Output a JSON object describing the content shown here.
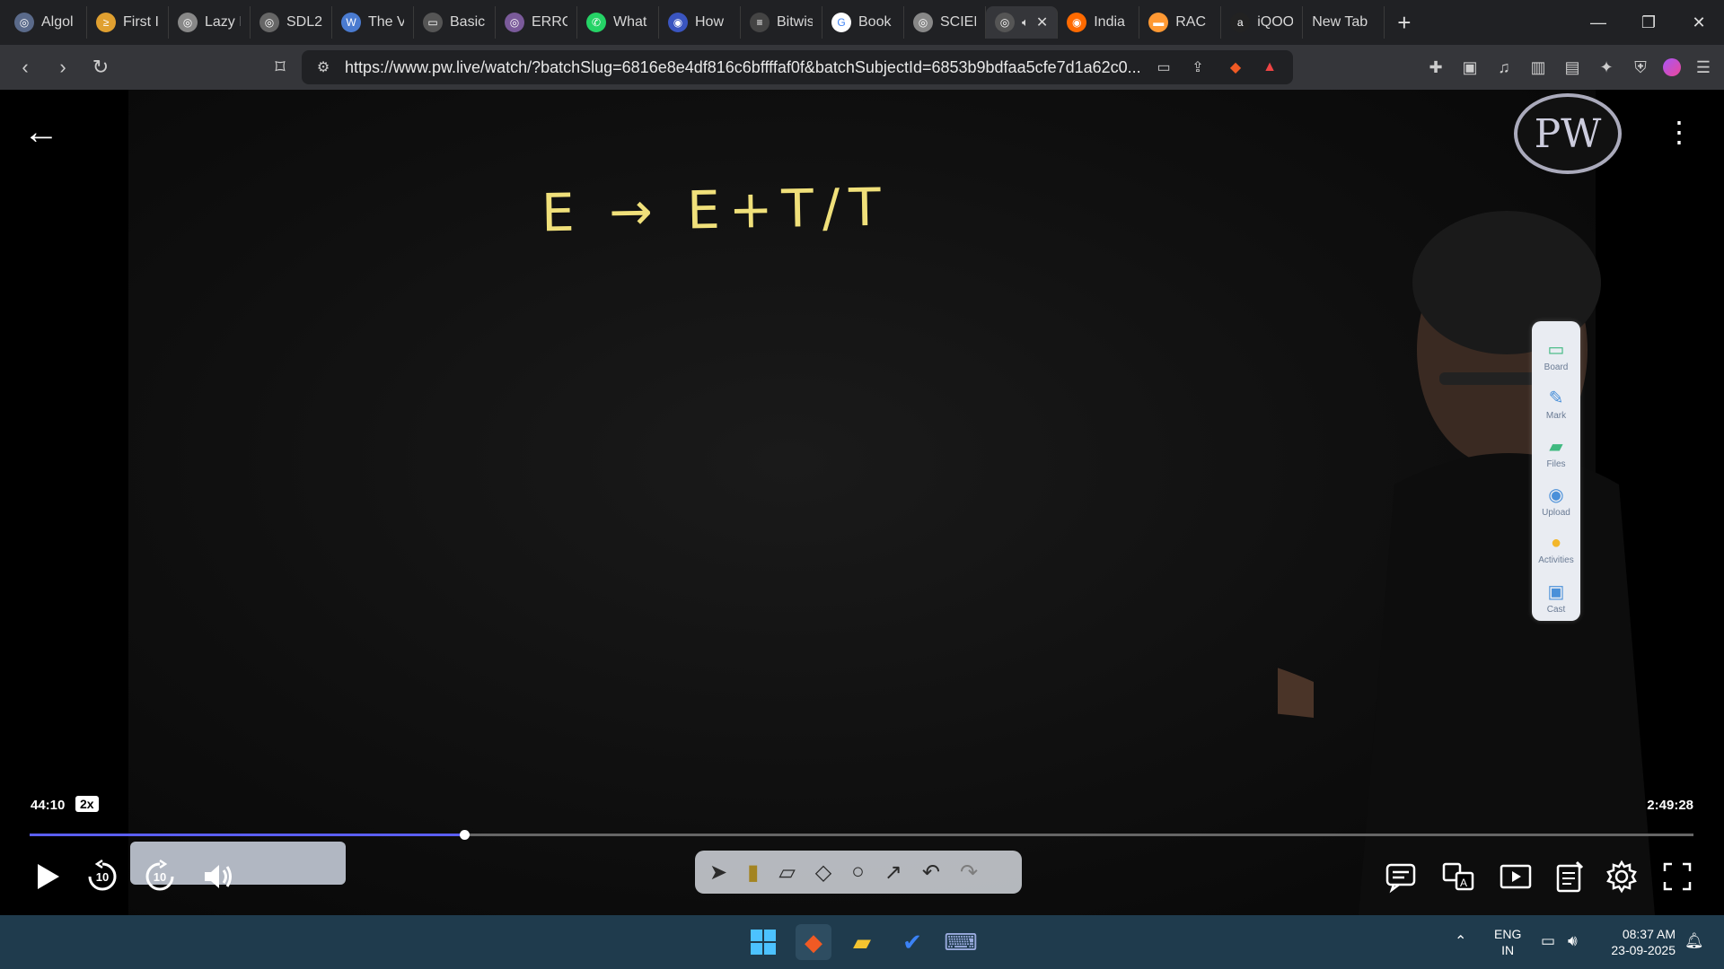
{
  "browser": {
    "tabs": [
      {
        "label": "Algol",
        "fav_color": "#5a6a8a",
        "fav_glyph": "◎"
      },
      {
        "label": "First I",
        "fav_color": "#e0a030",
        "fav_glyph": "≥"
      },
      {
        "label": "Lazy I",
        "fav_color": "#888888",
        "fav_glyph": "◎"
      },
      {
        "label": "SDL2",
        "fav_color": "#666666",
        "fav_glyph": "◎"
      },
      {
        "label": "The V",
        "fav_color": "#4a7bd0",
        "fav_glyph": "W"
      },
      {
        "label": "Basic",
        "fav_color": "#555555",
        "fav_glyph": "▭"
      },
      {
        "label": "ERRO",
        "fav_color": "#7a5a9a",
        "fav_glyph": "◎"
      },
      {
        "label": "What",
        "fav_color": "#25d366",
        "fav_glyph": "✆"
      },
      {
        "label": "How",
        "fav_color": "#3a55c0",
        "fav_glyph": "◉"
      },
      {
        "label": "Bitwis",
        "fav_color": "#444444",
        "fav_glyph": "≡"
      },
      {
        "label": "Book",
        "fav_color": "#ffffff",
        "fav_glyph": "G"
      },
      {
        "label": "SCIEN",
        "fav_color": "#888888",
        "fav_glyph": "◎"
      },
      {
        "label": "",
        "fav_color": "#555555",
        "fav_glyph": "◎",
        "active": true
      },
      {
        "label": "India",
        "fav_color": "#ff6a00",
        "fav_glyph": "◉"
      },
      {
        "label": "RAC",
        "fav_color": "#ff9933",
        "fav_glyph": "▬"
      },
      {
        "label": "iQOO",
        "fav_color": "#222222",
        "fav_glyph": "a"
      },
      {
        "label": "New Tab",
        "fav_color": "",
        "fav_glyph": ""
      }
    ],
    "url": "https://www.pw.live/watch/?batchSlug=6816e8e4df816c6bffffaf0f&batchSubjectId=6853b9bdfaa5cfe7d1a62c0..."
  },
  "video": {
    "board_text": "E → E+T/T",
    "logo_text": "PW",
    "side_tools": [
      {
        "label": "Board",
        "icon": "board-icon",
        "glyph": "▭"
      },
      {
        "label": "Mark",
        "icon": "pen-icon",
        "glyph": "✎"
      },
      {
        "label": "Files",
        "icon": "folder-icon",
        "glyph": "▰"
      },
      {
        "label": "Upload",
        "icon": "camera-icon",
        "glyph": "◉"
      },
      {
        "label": "Activities",
        "icon": "bulb-icon",
        "glyph": "●"
      },
      {
        "label": "Cast",
        "icon": "cast-icon",
        "glyph": "▣"
      }
    ],
    "current_time": "44:10",
    "speed": "2x",
    "duration": "2:49:28",
    "progress_fraction": 0.261,
    "skip_back_seconds": "10",
    "skip_forward_seconds": "10"
  },
  "taskbar": {
    "lang_top": "ENG",
    "lang_bottom": "IN",
    "time": "08:37 AM",
    "date": "23-09-2025"
  }
}
